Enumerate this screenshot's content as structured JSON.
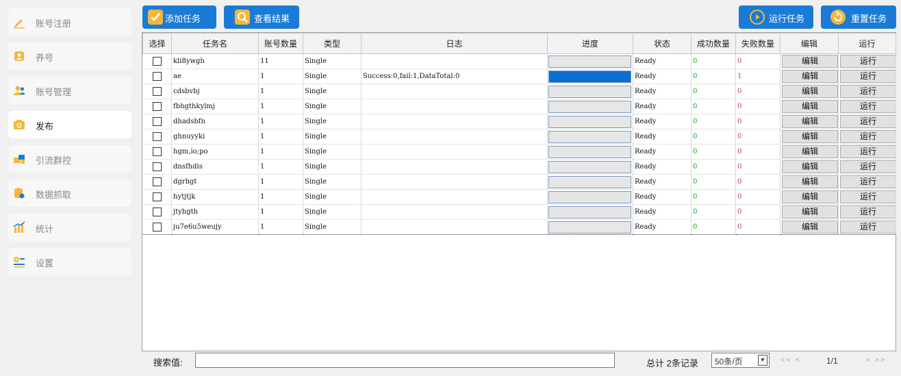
{
  "sidebar": {
    "items": [
      {
        "label": "账号注册",
        "icon": "pencil-icon"
      },
      {
        "label": "养号",
        "icon": "user-badge-icon"
      },
      {
        "label": "账号管理",
        "icon": "users-icon"
      },
      {
        "label": "发布",
        "icon": "camera-icon",
        "active": true
      },
      {
        "label": "引流群控",
        "icon": "devices-icon"
      },
      {
        "label": "数据抓取",
        "icon": "database-icon"
      },
      {
        "label": "统计",
        "icon": "bar-chart-icon"
      },
      {
        "label": "设置",
        "icon": "settings-icon"
      }
    ]
  },
  "toolbar": {
    "add_task": "添加任务",
    "view_results": "查看结果",
    "run_task": "运行任务",
    "reset_task": "重置任务"
  },
  "table": {
    "headers": [
      "选择",
      "任务名",
      "账号数量",
      "类型",
      "日志",
      "进度",
      "状态",
      "成功数量",
      "失败数量",
      "编辑",
      "运行"
    ],
    "edit_label": "编辑",
    "run_label": "运行",
    "rows": [
      {
        "name": "kli8ywgh",
        "count": "11",
        "type": "Single",
        "log": "",
        "progress": 0,
        "status": "Ready",
        "success": "0",
        "fail": "0"
      },
      {
        "name": "ae",
        "count": "1",
        "type": "Single",
        "log": "Success:0,fail:1,DataTotal:0",
        "progress": 1,
        "status": "Ready",
        "success": "0",
        "fail": "1"
      },
      {
        "name": "cdsbvbj",
        "count": "1",
        "type": "Single",
        "log": "",
        "progress": 0,
        "status": "Ready",
        "success": "0",
        "fail": "0"
      },
      {
        "name": "fbhgthkylmj",
        "count": "1",
        "type": "Single",
        "log": "",
        "progress": 0,
        "status": "Ready",
        "success": "0",
        "fail": "0"
      },
      {
        "name": "dhadsbfn",
        "count": "1",
        "type": "Single",
        "log": "",
        "progress": 0,
        "status": "Ready",
        "success": "0",
        "fail": "0"
      },
      {
        "name": "ghnuyyki",
        "count": "1",
        "type": "Single",
        "log": "",
        "progress": 0,
        "status": "Ready",
        "success": "0",
        "fail": "0"
      },
      {
        "name": "hgm,io;po",
        "count": "1",
        "type": "Single",
        "log": "",
        "progress": 0,
        "status": "Ready",
        "success": "0",
        "fail": "0"
      },
      {
        "name": "dnsfhdis",
        "count": "1",
        "type": "Single",
        "log": "",
        "progress": 0,
        "status": "Ready",
        "success": "0",
        "fail": "0"
      },
      {
        "name": "dgrhgt",
        "count": "1",
        "type": "Single",
        "log": "",
        "progress": 0,
        "status": "Ready",
        "success": "0",
        "fail": "0"
      },
      {
        "name": "hytjtjk",
        "count": "1",
        "type": "Single",
        "log": "",
        "progress": 0,
        "status": "Ready",
        "success": "0",
        "fail": "0"
      },
      {
        "name": "jtyhgth",
        "count": "1",
        "type": "Single",
        "log": "",
        "progress": 0,
        "status": "Ready",
        "success": "0",
        "fail": "0"
      },
      {
        "name": "ju7e6u5weujy",
        "count": "1",
        "type": "Single",
        "log": "",
        "progress": 0,
        "status": "Ready",
        "success": "0",
        "fail": "0"
      }
    ]
  },
  "footer": {
    "search_label": "搜索值:",
    "search_value": "",
    "total": "总计 2条记录",
    "page_size": "50条/页",
    "first_prev": "<< <",
    "page": "1/1",
    "next_last": "> >>"
  },
  "colors": {
    "accent": "#1a7bd6",
    "icon_accent": "#f4b63c",
    "progress_fill": "#0a6fd1",
    "success": "#1a9e1a",
    "fail": "#d43b3b"
  }
}
